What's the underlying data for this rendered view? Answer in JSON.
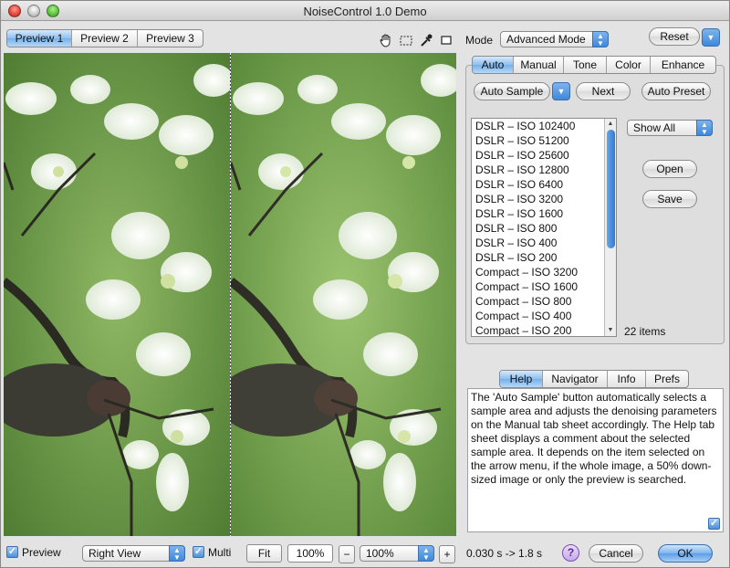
{
  "window": {
    "title": "NoiseControl 1.0 Demo"
  },
  "toolbar": {
    "preview_tabs": [
      "Preview 1",
      "Preview 2",
      "Preview 3"
    ],
    "mode_label": "Mode",
    "mode_value": "Advanced Mode",
    "reset_label": "Reset"
  },
  "auto_panel": {
    "tabs": [
      "Auto",
      "Manual",
      "Tone",
      "Color",
      "Enhance"
    ],
    "auto_sample_label": "Auto Sample",
    "next_label": "Next",
    "auto_preset_label": "Auto Preset",
    "list_items": [
      "DSLR – ISO 102400",
      "DSLR – ISO 51200",
      "DSLR – ISO 25600",
      "DSLR – ISO 12800",
      "DSLR – ISO 6400",
      "DSLR – ISO 3200",
      "DSLR – ISO 1600",
      "DSLR – ISO 800",
      "DSLR – ISO 400",
      "DSLR – ISO 200",
      "Compact – ISO 3200",
      "Compact – ISO 1600",
      "Compact – ISO 800",
      "Compact – ISO 400",
      "Compact – ISO 200"
    ],
    "filter_value": "Show All",
    "open_label": "Open",
    "save_label": "Save",
    "item_count": "22 items"
  },
  "info_panel": {
    "tabs": [
      "Help",
      "Navigator",
      "Info",
      "Prefs"
    ],
    "help_text": "The 'Auto Sample' button automatically selects a sample area and adjusts the denoising parameters on the Manual tab sheet accordingly. The Help tab sheet displays a comment about the selected sample area. It depends on the item selected on the arrow menu, if the whole image, a 50% down-sized image or only the preview is searched."
  },
  "bottom_bar": {
    "preview_label": "Preview",
    "view_value": "Right View",
    "multi_label": "Multi",
    "fit_label": "Fit",
    "zoom_readout": "100%",
    "minus_label": "−",
    "zoom_value": "100%",
    "plus_label": "+",
    "timing": "0.030 s -> 1.8 s",
    "help_glyph": "?",
    "cancel_label": "Cancel",
    "ok_label": "OK"
  },
  "colors": {
    "accent": "#5d9ee6",
    "selected_tab": "#8fbfef",
    "foliage": "#5a8a3a"
  }
}
